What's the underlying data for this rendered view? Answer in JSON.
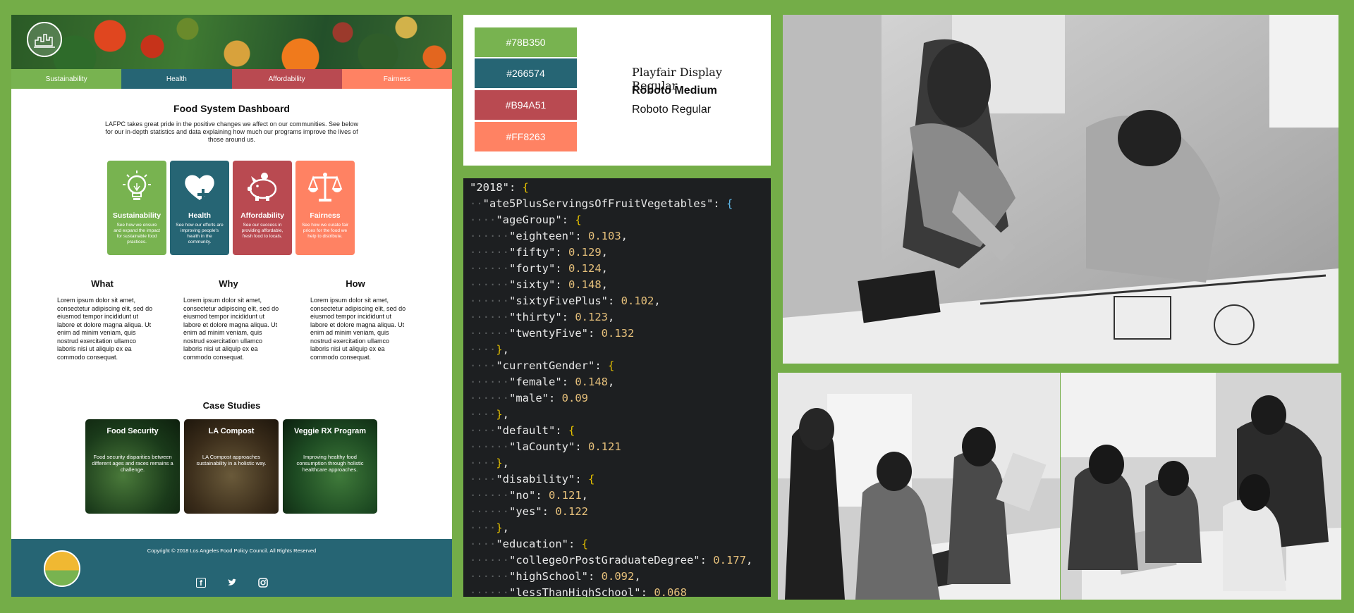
{
  "dashboard": {
    "nav": [
      {
        "label": "Sustainability",
        "color": "#78B350"
      },
      {
        "label": "Health",
        "color": "#266574"
      },
      {
        "label": "Affordability",
        "color": "#B94A51"
      },
      {
        "label": "Fairness",
        "color": "#FF8263"
      }
    ],
    "title": "Food System Dashboard",
    "intro": "LAFPC takes great pride in the positive changes we affect on our communities. See below for our in-depth statistics and data explaining how much our programs improve the lives of those around us.",
    "cards": [
      {
        "title": "Sustainability",
        "desc": "See how we ensure and expand the impact for sustainable food practices.",
        "icon": "lightbulb-icon",
        "color": "#78B350"
      },
      {
        "title": "Health",
        "desc": "See how our efforts are improving people's health in the community.",
        "icon": "heart-plus-icon",
        "color": "#266574"
      },
      {
        "title": "Affordability",
        "desc": "See our success in providing affordable, fresh food to locals.",
        "icon": "piggy-bank-icon",
        "color": "#B94A51"
      },
      {
        "title": "Fairness",
        "desc": "See how we curate fair prices for the food we help to distribute.",
        "icon": "scales-icon",
        "color": "#FF8263"
      }
    ],
    "columns": [
      {
        "heading": "What",
        "text": "Lorem ipsum dolor sit amet, consectetur adipiscing elit, sed do eiusmod tempor incididunt ut labore et dolore magna aliqua. Ut enim ad minim veniam, quis nostrud exercitation ullamco laboris nisi ut aliquip ex ea commodo consequat."
      },
      {
        "heading": "Why",
        "text": "Lorem ipsum dolor sit amet, consectetur adipiscing elit, sed do eiusmod tempor incididunt ut labore et dolore magna aliqua. Ut enim ad minim veniam, quis nostrud exercitation ullamco laboris nisi ut aliquip ex ea commodo consequat."
      },
      {
        "heading": "How",
        "text": "Lorem ipsum dolor sit amet, consectetur adipiscing elit, sed do eiusmod tempor incididunt ut labore et dolore magna aliqua. Ut enim ad minim veniam, quis nostrud exercitation ullamco laboris nisi ut aliquip ex ea commodo consequat."
      }
    ],
    "case_studies_title": "Case Studies",
    "case_studies": [
      {
        "title": "Food Security",
        "desc": "Food security disparities between different ages and races remains a challenge."
      },
      {
        "title": "LA Compost",
        "desc": "LA Compost approaches sustainability in a holistic way."
      },
      {
        "title": "Veggie RX Program",
        "desc": "Improving healthy food consumption through holistic healthcare approaches."
      }
    ],
    "copyright": "Copyright © 2018 Los Angeles Food Policy Council. All Rights Reserved",
    "social_icons": [
      "facebook-icon",
      "twitter-icon",
      "instagram-icon"
    ]
  },
  "style_guide": {
    "swatches": [
      "#78B350",
      "#266574",
      "#B94A51",
      "#FF8263"
    ],
    "fonts": [
      "Playfair Display Regular",
      "Roboto Medium",
      "Roboto Regular"
    ]
  },
  "code": {
    "year_key": "\"2018\"",
    "metric_key": "\"ate5PlusServingsOfFruitVegetables\"",
    "groups": [
      {
        "key": "\"ageGroup\"",
        "entries": [
          [
            "\"eighteen\"",
            "0.103"
          ],
          [
            "\"fifty\"",
            "0.129"
          ],
          [
            "\"forty\"",
            "0.124"
          ],
          [
            "\"sixty\"",
            "0.148"
          ],
          [
            "\"sixtyFivePlus\"",
            "0.102"
          ],
          [
            "\"thirty\"",
            "0.123"
          ],
          [
            "\"twentyFive\"",
            "0.132"
          ]
        ]
      },
      {
        "key": "\"currentGender\"",
        "entries": [
          [
            "\"female\"",
            "0.148"
          ],
          [
            "\"male\"",
            "0.09"
          ]
        ]
      },
      {
        "key": "\"default\"",
        "entries": [
          [
            "\"laCounty\"",
            "0.121"
          ]
        ]
      },
      {
        "key": "\"disability\"",
        "entries": [
          [
            "\"no\"",
            "0.121"
          ],
          [
            "\"yes\"",
            "0.122"
          ]
        ]
      },
      {
        "key": "\"education\"",
        "entries": [
          [
            "\"collegeOrPostGraduateDegree\"",
            "0.177"
          ],
          [
            "\"highSchool\"",
            "0.092"
          ],
          [
            "\"lessThanHighSchool\"",
            "0.068"
          ]
        ]
      }
    ]
  },
  "colors": {
    "page_bg": "#74AD48",
    "code_bg": "#1D1F21",
    "footer": "#266574"
  }
}
